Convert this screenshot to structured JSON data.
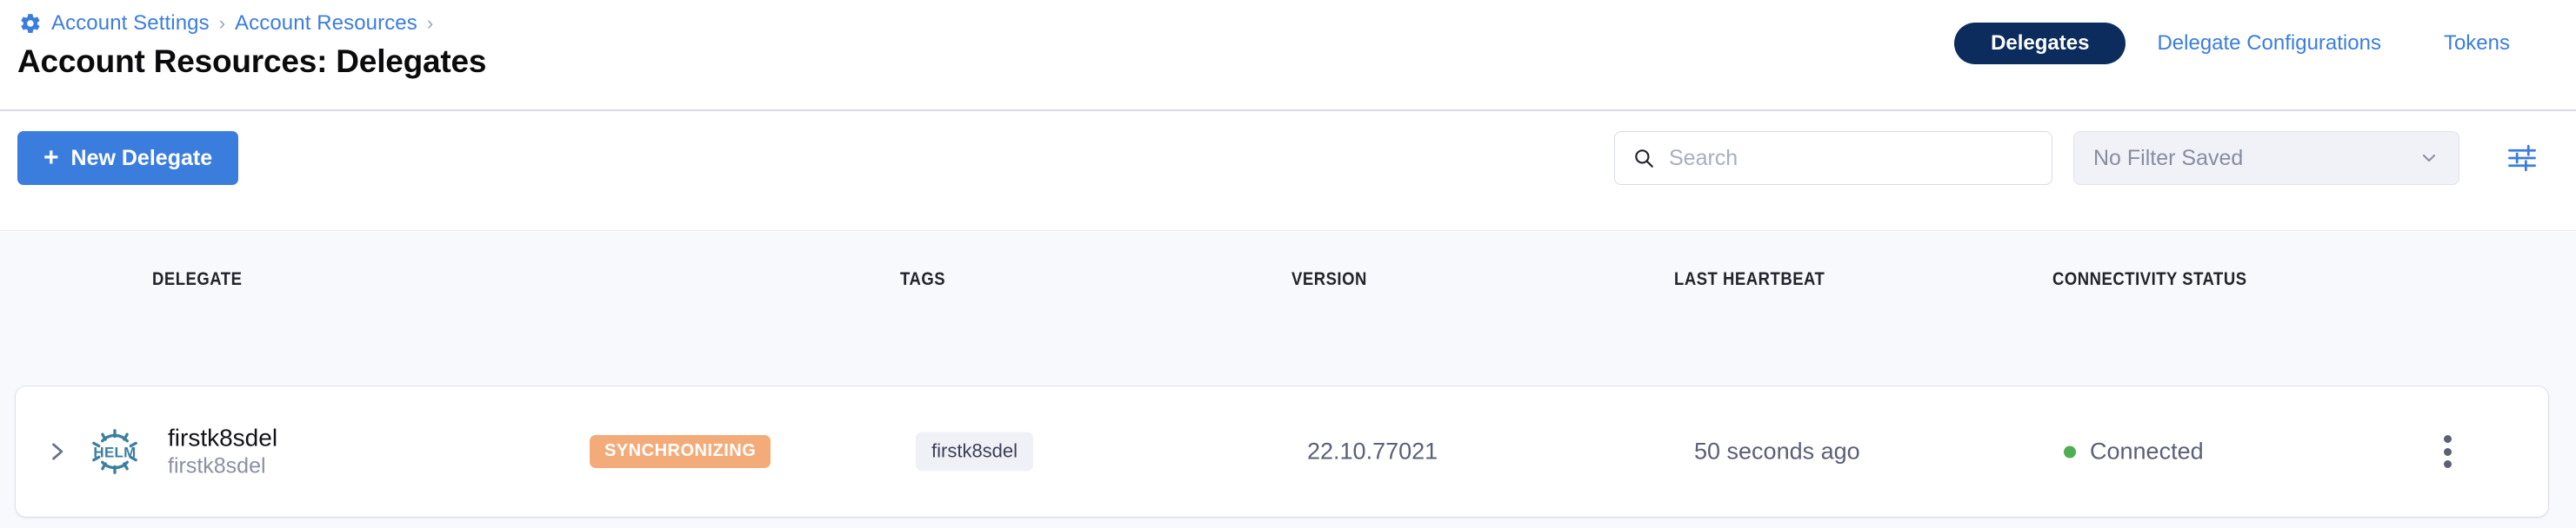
{
  "breadcrumb": {
    "gear_icon": "gear-icon",
    "items": [
      {
        "label": "Account Settings"
      },
      {
        "label": "Account Resources"
      }
    ],
    "separator": "›"
  },
  "header": {
    "title": "Account Resources: Delegates",
    "tabs": [
      {
        "label": "Delegates",
        "active": true
      },
      {
        "label": "Delegate Configurations",
        "active": false
      },
      {
        "label": "Tokens",
        "active": false
      }
    ]
  },
  "toolbar": {
    "new_delegate_label": "New Delegate",
    "plus_icon": "+",
    "search": {
      "icon": "search-icon",
      "value": "",
      "placeholder": "Search"
    },
    "filter": {
      "selected": "No Filter Saved",
      "chevron_icon": "chevron-down-icon"
    },
    "filter_settings_icon": "sliders-icon"
  },
  "table": {
    "columns": [
      "DELEGATE",
      "TAGS",
      "VERSION",
      "LAST HEARTBEAT",
      "CONNECTIVITY STATUS"
    ],
    "rows": [
      {
        "expand_icon": "chevron-right-icon",
        "type_icon": "helm-icon",
        "type_icon_label": "HELM",
        "name": "firstk8sdel",
        "sub_name": "firstk8sdel",
        "status_badge": "SYNCHRONIZING",
        "tags": [
          "firstk8sdel"
        ],
        "version": "22.10.77021",
        "last_heartbeat": "50 seconds ago",
        "connectivity_status": "Connected",
        "menu_icon": "more-vertical-icon"
      }
    ]
  },
  "colors": {
    "primary_blue": "#3b7ddd",
    "active_tab_navy": "#0b2c5d",
    "synchronizing_orange": "#f3ab79",
    "connected_green": "#4caf50",
    "helm_teal": "#3d7e9f",
    "table_bg": "#f8f9fd"
  }
}
